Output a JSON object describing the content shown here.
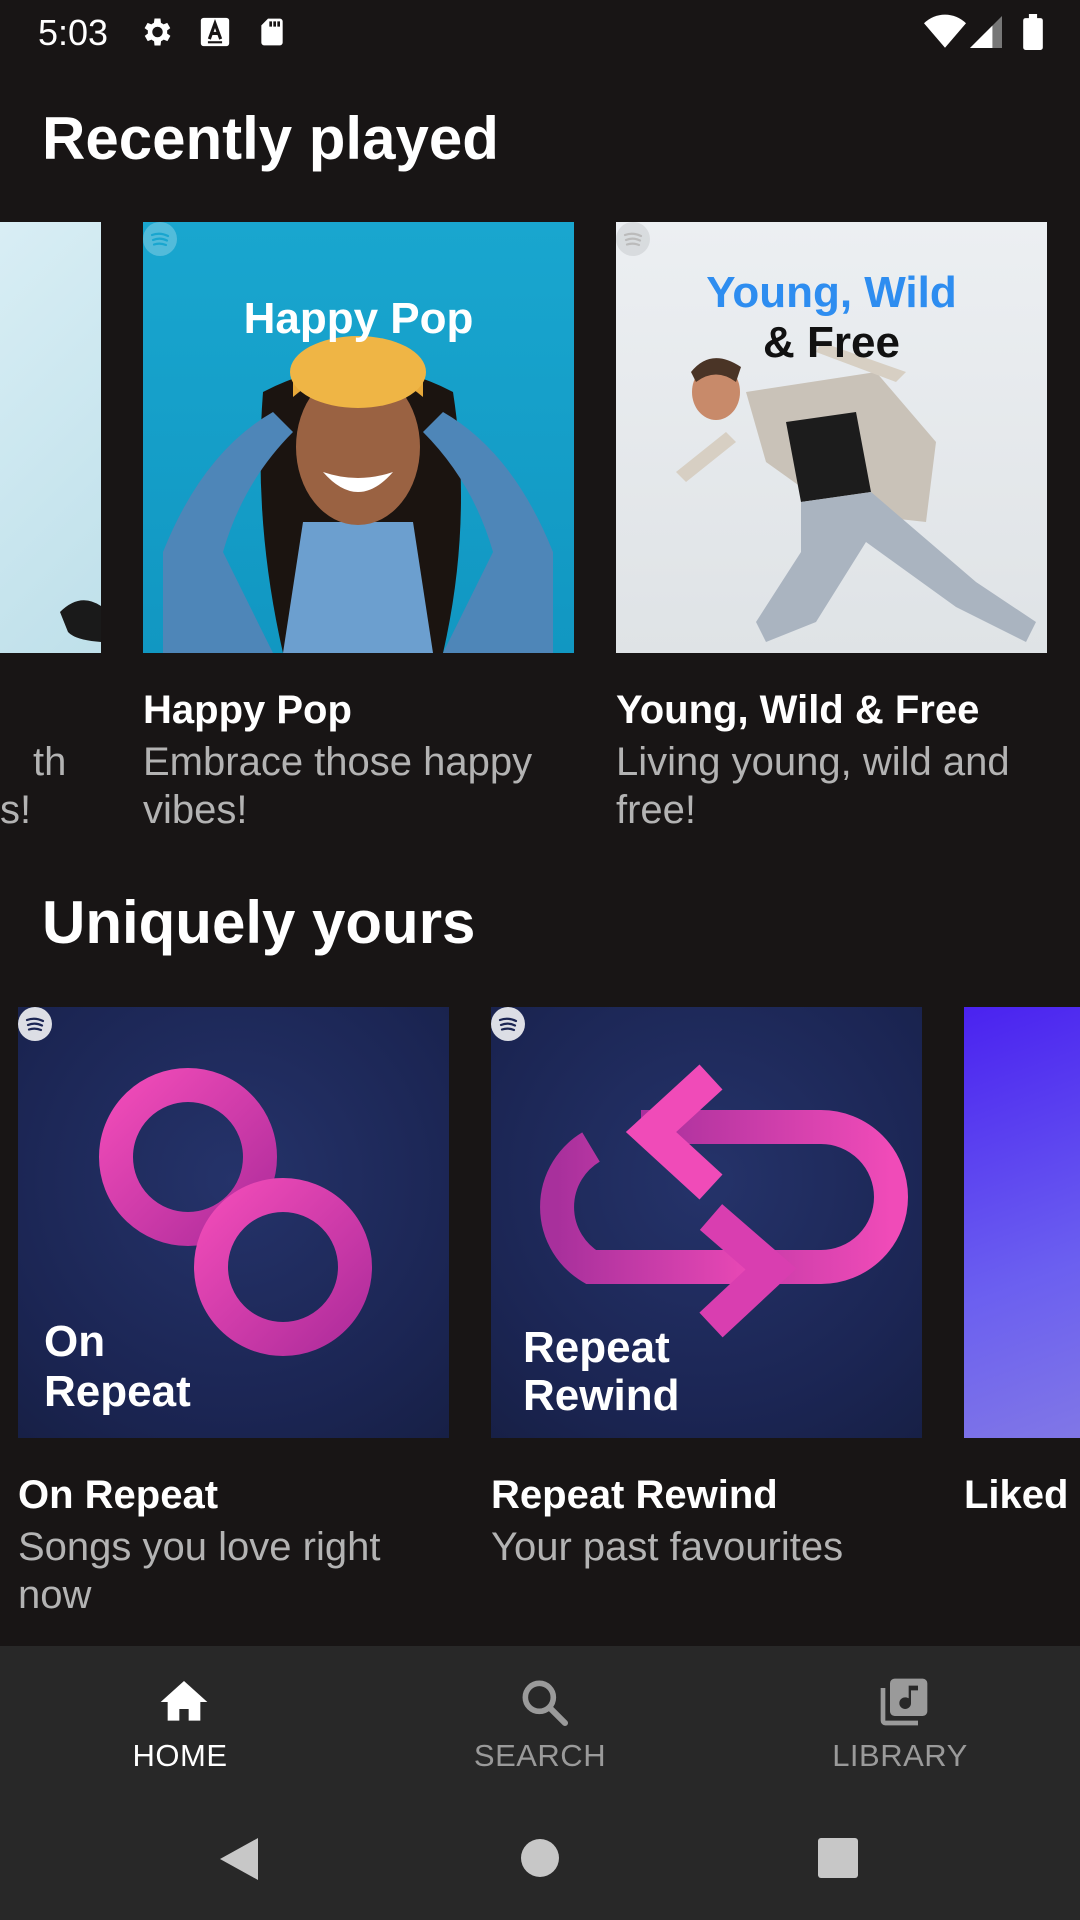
{
  "status_bar": {
    "time": "5:03",
    "icons": [
      "gear-icon",
      "a-keyboard-icon",
      "sd-card-icon",
      "wifi-icon",
      "signal-icon",
      "battery-icon"
    ]
  },
  "sections": [
    {
      "title": "Recently played",
      "cards": [
        {
          "title": "",
          "subtitle_lines": [
            "th",
            "s!"
          ],
          "partial": true
        },
        {
          "title": "Happy Pop",
          "subtitle": "Embrace those happy vibes!",
          "cover_text": "Happy Pop"
        },
        {
          "title": "Young, Wild & Free",
          "subtitle": "Living young, wild and free!",
          "cover_line1": "Young, Wild",
          "cover_line2": "& Free"
        }
      ]
    },
    {
      "title": "Uniquely yours",
      "cards": [
        {
          "title": "On Repeat",
          "subtitle": "Songs you love right now",
          "cover_line1": "On",
          "cover_line2": "Repeat"
        },
        {
          "title": "Repeat Rewind",
          "subtitle": "Your past favourites",
          "cover_line1": "Repeat",
          "cover_line2": "Rewind"
        },
        {
          "title": "Liked S",
          "partial": true
        }
      ]
    }
  ],
  "bottom_nav": {
    "items": [
      {
        "label": "HOME",
        "icon": "home-icon",
        "active": true
      },
      {
        "label": "SEARCH",
        "icon": "search-icon",
        "active": false
      },
      {
        "label": "LIBRARY",
        "icon": "library-icon",
        "active": false
      }
    ]
  },
  "colors": {
    "background": "#181515",
    "nav_background": "#282828",
    "text_primary": "#ffffff",
    "text_secondary": "#b3b3b3",
    "nav_inactive": "#9a9a9a",
    "happy_pop_cover": "#1da0c8",
    "repeat_cover": "#1e2a55",
    "magenta_accent": "#e83fb4"
  }
}
